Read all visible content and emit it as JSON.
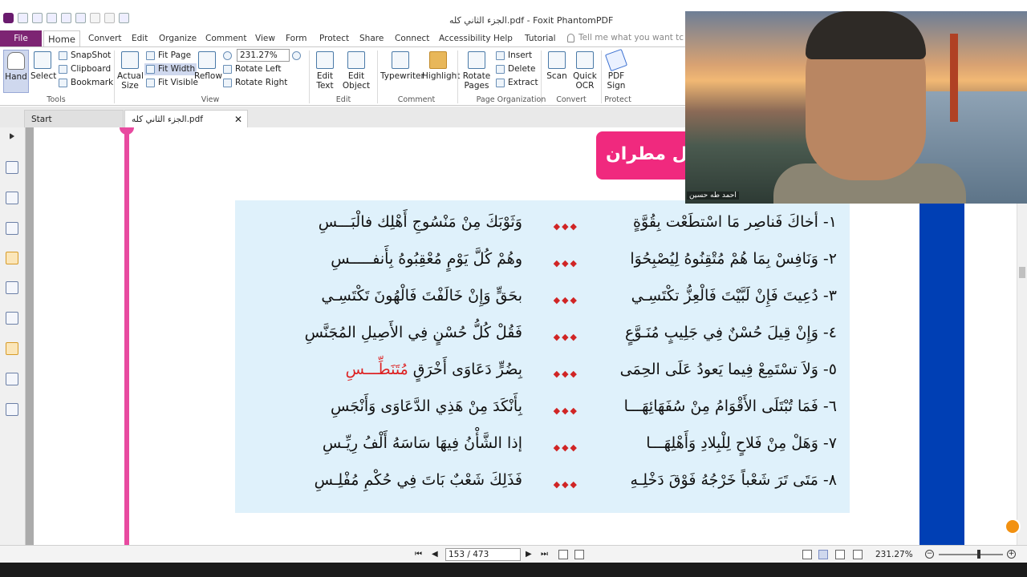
{
  "window": {
    "title": "الجزء الثاني كله.pdf - Foxit PhantomPDF"
  },
  "menu_tabs": [
    "File",
    "Home",
    "Convert",
    "Edit",
    "Organize",
    "Comment",
    "View",
    "Form",
    "Protect",
    "Share",
    "Connect",
    "Accessibility",
    "Help",
    "Tutorial"
  ],
  "tell_me": "Tell me what you want tc",
  "ribbon": {
    "tools": {
      "hand": "Hand",
      "select": "Select",
      "snapshot": "SnapShot",
      "clipboard": "Clipboard",
      "bookmark": "Bookmark",
      "label": "Tools"
    },
    "view": {
      "actual_size_1": "Actual",
      "actual_size_2": "Size",
      "fit_page": "Fit Page",
      "fit_width": "Fit Width",
      "fit_visible": "Fit Visible",
      "reflow": "Reflow",
      "zoom": "231.27%",
      "rotate_left": "Rotate Left",
      "rotate_right": "Rotate Right",
      "label": "View"
    },
    "edit": {
      "edit_text_1": "Edit",
      "edit_text_2": "Text",
      "edit_object_1": "Edit",
      "edit_object_2": "Object",
      "label": "Edit"
    },
    "comment": {
      "typewriter": "Typewriter",
      "highlight": "Highlight",
      "label": "Comment"
    },
    "organize": {
      "rotate_pages_1": "Rotate",
      "rotate_pages_2": "Pages",
      "insert": "Insert",
      "delete": "Delete",
      "extract": "Extract",
      "label": "Page Organization"
    },
    "convert": {
      "scan": "Scan",
      "quick_ocr_1": "Quick",
      "quick_ocr_2": "OCR",
      "label": "Convert"
    },
    "protect": {
      "pdf_sign_1": "PDF",
      "pdf_sign_2": "Sign",
      "label": "Protect"
    }
  },
  "doc_tabs": {
    "start": "Start",
    "doc": "الجزء الثاني كله.pdf",
    "close": "✕"
  },
  "document": {
    "heading": "ل مطران:",
    "stars": "◆◆◆",
    "lines": [
      {
        "right": "١- أخاكَ فَناصِر مَا اسْتطَعْت بِقُوَّةٍ",
        "left": "وَثَوْبَكَ مِنْ مَنْسُوجِ أَهْلِك فالْبَـــسِ"
      },
      {
        "right": "٢- وَنَافِسْ بِمَا هُمْ مُتْقِنُوهُ لِيُصْبِحُوَا",
        "left": "وهُمْ كُلَّ يَوْمٍ مُعْقِبُوهُ بِأَنفـــــسِ"
      },
      {
        "right": "٣- دُعِيتَ فَإِنْ لَبَّيْتَ فَالْعِزُّ تكْتَسِـي",
        "left": "بحَقٍّ وَإِنْ خَالَفْتَ فَالْهُونَ تَكْتَسِـي"
      },
      {
        "right": "٤- وَإِنْ قِيلَ حُسْنٌ فِي جَلِيبٍ مُنَـوَّعٍ",
        "left": "فَقُلْ كُلُّ حُسْنٍ فِي الأَصِيلِ المُجَنَّسِ"
      },
      {
        "right": "٥- وَلاَ تسْتَمِعْ فِيما يَعودُ عَلَى الحِمَى",
        "left_a": "بِضُرٍّ دَعَاوَى أَخْرَقٍ ",
        "left_b": "مُتَنَطِّـــسِ"
      },
      {
        "right": "٦- فَمَا تُبْتَلَى الأَقْوَامُ مِنْ سُفَهَائِهَـــا",
        "left": "بِأَنْكَدَ مِنْ هَذِي الدَّعَاوَى وَأَنْجَسِ"
      },
      {
        "right": "٧- وَهَلْ مِنْ فَلاحٍ لِلْبِلادِ وَأَهْلِهَـــا",
        "left": "إذا الشَّأْنُ فِيهَا سَاسَهُ أَلْفُ رِيِّـسِ"
      },
      {
        "right": "٨- مَتَى تَرَ شَعْباً خَرْجُهُ فَوْقَ دَخْلِـهِ",
        "left": "فَذَلِكَ شَعْبٌ بَاتَ فِي حُكْمِ مُفْلِـسِ"
      }
    ]
  },
  "webcam": {
    "caption": "احمد طه حسين"
  },
  "status": {
    "page": "153 / 473",
    "zoom": "231.27%",
    "minus": "−",
    "plus": "+"
  },
  "colors": {
    "file_tab": "#7d2473",
    "heading_bg": "#f0297e",
    "poem_bg": "#dff1fb",
    "pink_bar": "#e84aa0",
    "blue_bar": "#003fb4",
    "accent_red": "#d22222"
  }
}
